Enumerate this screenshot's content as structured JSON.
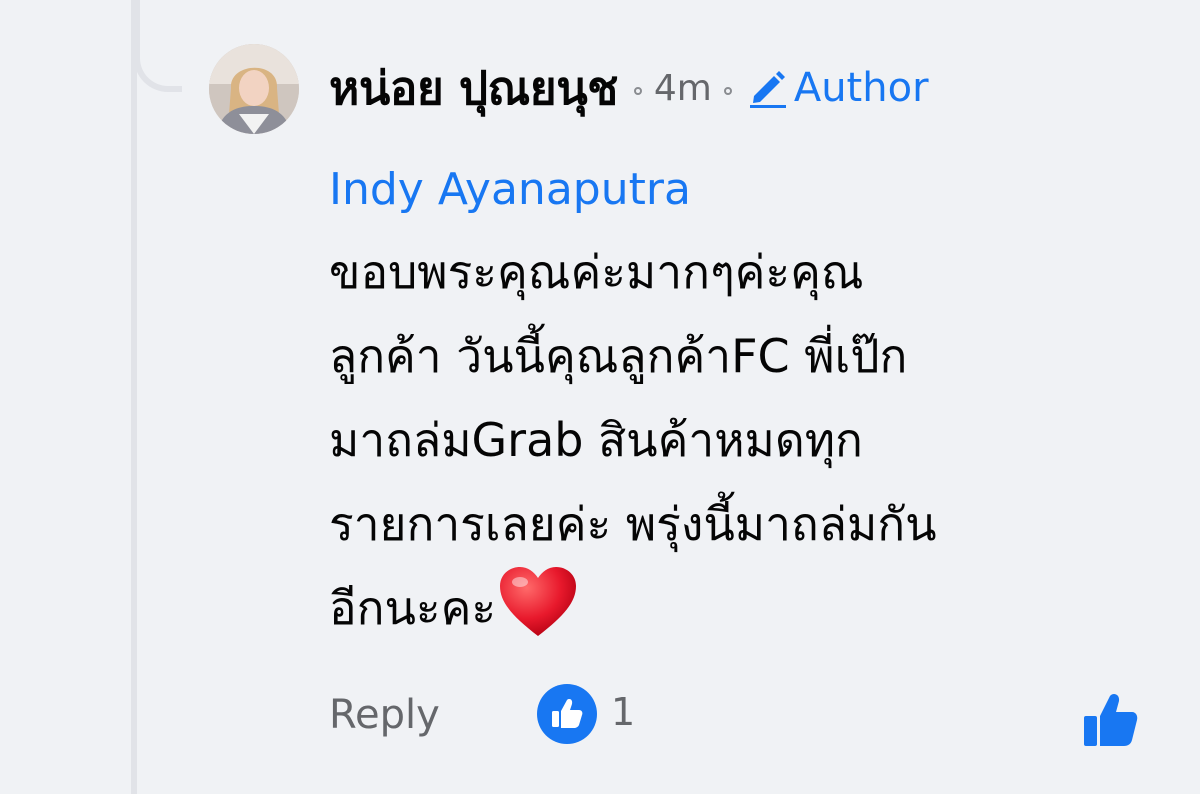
{
  "comment": {
    "author_name": "หน่อย ปุณยนุช",
    "time": "4m",
    "author_badge": "Author",
    "mention": "Indy Ayanaputra",
    "text": "ขอบพระคุณค่ะมากๆค่ะคุณ\nลูกค้า วันนี้คุณลูกค้าFC พี่เป๊ก\nมาถล่มGrab สินค้าหมดทุก\nรายการเลยค่ะ พรุ่งนี้มาถล่มกัน\nอีกนะคะ"
  },
  "actions": {
    "reply_label": "Reply",
    "like_count": "1"
  },
  "icons": {
    "badge": "pen-icon",
    "reaction": "like-thumb-icon",
    "emoji": "heart-icon",
    "like_button": "thumbs-up-icon"
  },
  "colors": {
    "background": "#f0f2f5",
    "link_blue": "#1877f2",
    "text_primary": "#050505",
    "text_secondary": "#65676b",
    "heart_red": "#e8192c"
  }
}
